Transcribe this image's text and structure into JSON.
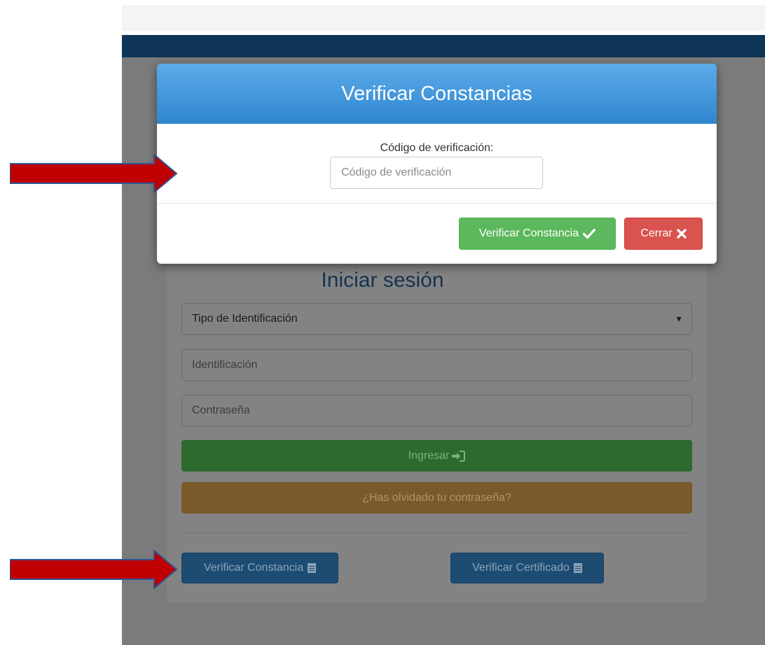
{
  "modal": {
    "title": "Verificar Constancias",
    "code_label": "Código de verificación:",
    "code_placeholder": "Código de verificación",
    "verify_button": "Verificar Constancia",
    "close_button": "Cerrar"
  },
  "login": {
    "title": "Iniciar sesión",
    "id_type_select": "Tipo de Identificación",
    "id_placeholder": "Identificación",
    "password_placeholder": "Contraseña",
    "login_button": "Ingresar",
    "forgot_button": "¿Has olvidado tu contraseña?",
    "verify_constancia_button": "Verificar Constancia",
    "verify_certificado_button": "Verificar Certificado"
  },
  "icons": {
    "check": "check-icon",
    "close": "times-icon",
    "login": "sign-in-icon",
    "document": "list-alt-icon",
    "caret": "caret-down-icon"
  },
  "colors": {
    "navbar": "#0e3457",
    "modal_header": "#3c93dc",
    "success": "#5cb85c",
    "danger": "#d9534f",
    "annotation_arrow": "#c00000"
  }
}
